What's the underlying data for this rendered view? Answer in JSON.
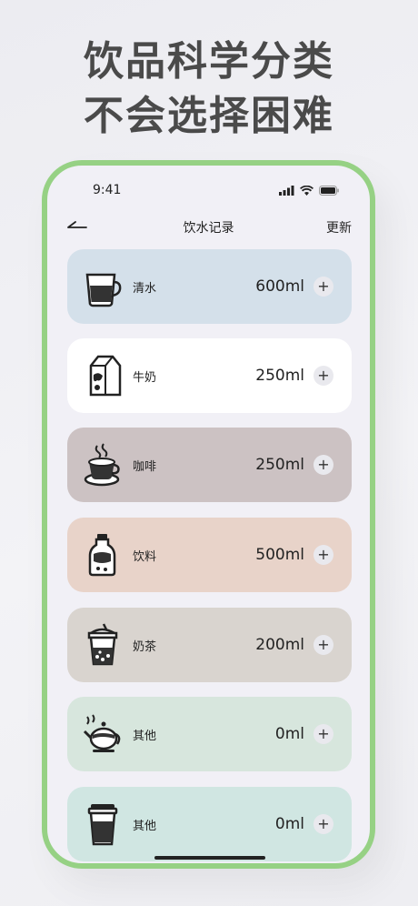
{
  "headline": {
    "line1": "饮品科学分类",
    "line2": "不会选择困难"
  },
  "status": {
    "time": "9:41"
  },
  "nav": {
    "title": "饮水记录",
    "update": "更新"
  },
  "colors": {
    "frame": "#96d184",
    "card_water": "#d4e0ea",
    "card_milk": "#ffffff",
    "card_coffee": "#ccc2c3",
    "card_drink": "#e8d3c9",
    "card_tea": "#d9d4cf",
    "card_other1": "#d7e6dd",
    "card_other2": "#d0e6e2"
  },
  "drinks": [
    {
      "name": "清水",
      "amount": "600ml",
      "icon": "water-glass-icon"
    },
    {
      "name": "牛奶",
      "amount": "250ml",
      "icon": "milk-carton-icon"
    },
    {
      "name": "咖啡",
      "amount": "250ml",
      "icon": "coffee-cup-icon"
    },
    {
      "name": "饮料",
      "amount": "500ml",
      "icon": "soda-bottle-icon"
    },
    {
      "name": "奶茶",
      "amount": "200ml",
      "icon": "bubble-tea-icon"
    },
    {
      "name": "其他",
      "amount": "0ml",
      "icon": "teapot-icon"
    },
    {
      "name": "其他",
      "amount": "0ml",
      "icon": "takeaway-cup-icon"
    }
  ],
  "plus_symbol": "+"
}
